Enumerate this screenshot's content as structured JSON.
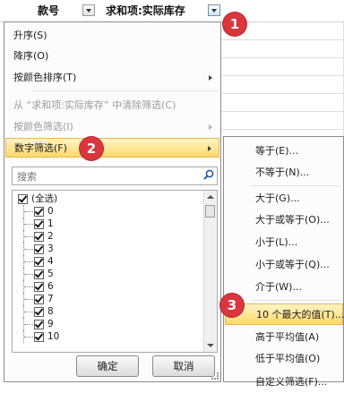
{
  "header": {
    "col_a_label": "款号",
    "col_b_label": "求和项:实际库存"
  },
  "badges": [
    "1",
    "2",
    "3"
  ],
  "menu": {
    "sort_asc": "升序(S)",
    "sort_desc": "降序(O)",
    "sort_by_color": "按颜色排序(T)",
    "clear_filter": "从 “求和项:实际库存” 中清除筛选(C)",
    "filter_by_color": "按颜色筛选(I)",
    "number_filters": "数字筛选(F)"
  },
  "search": {
    "placeholder": "搜索"
  },
  "list_items": [
    "(全选)",
    "0",
    "1",
    "2",
    "3",
    "4",
    "5",
    "6",
    "7",
    "8",
    "9",
    "10"
  ],
  "buttons": {
    "ok": "确定",
    "cancel": "取消"
  },
  "submenu": {
    "equals": "等于(E)...",
    "not_equals": "不等于(N)...",
    "greater_than": "大于(G)...",
    "greater_or_equal": "大于或等于(O)...",
    "less_than": "小于(L)...",
    "less_or_equal": "小于或等于(Q)...",
    "between": "介于(W)...",
    "top10": "10 个最大的值(T)...",
    "above_average": "高于平均值(A)",
    "below_average": "低于平均值(O)",
    "custom": "自定义筛选(F)..."
  },
  "colors": {
    "badge": "#d9363e",
    "highlight": "#ffd96a"
  }
}
